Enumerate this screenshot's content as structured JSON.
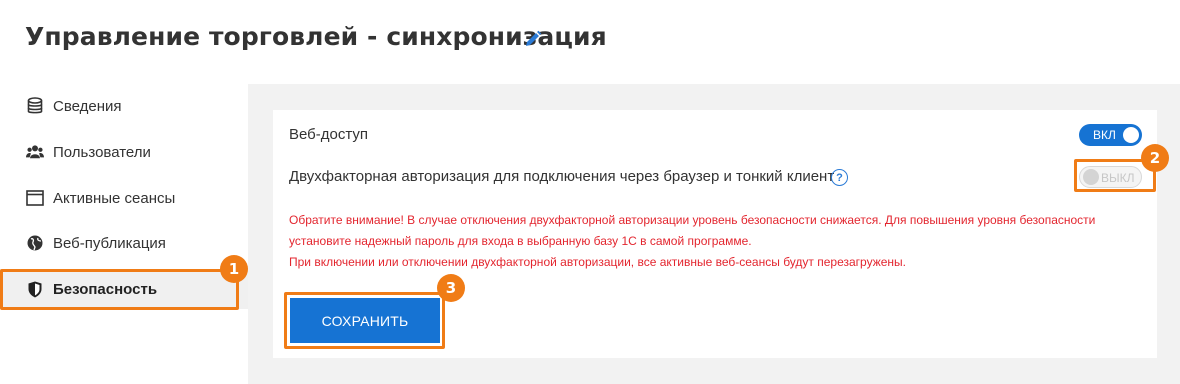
{
  "page": {
    "title": "Управление торговлей - синхронизация"
  },
  "sidebar": {
    "items": [
      {
        "label": "Сведения",
        "icon": "database-icon"
      },
      {
        "label": "Пользователи",
        "icon": "users-icon"
      },
      {
        "label": "Активные сеансы",
        "icon": "window-icon"
      },
      {
        "label": "Веб-публикация",
        "icon": "globe-icon"
      },
      {
        "label": "Безопасность",
        "icon": "shield-icon",
        "active": true
      }
    ]
  },
  "settings": {
    "web_access": {
      "label": "Веб-доступ",
      "toggle_label": "ВКЛ",
      "state": "on"
    },
    "two_factor": {
      "label": "Двухфакторная авторизация для подключения через браузер и тонкий клиент",
      "help": "?",
      "toggle_label": "ВЫКЛ",
      "state": "off"
    },
    "warning_lines": [
      "Обратите внимание! В случае отключения двухфакторной авторизации уровень безопасности снижается. Для повышения уровня безопасности",
      "установите надежный пароль для входа в выбранную базу 1С в самой программе.",
      "При включении или отключении двухфакторной авторизации, все активные веб-сеансы будут перезагружены."
    ]
  },
  "actions": {
    "save_label": "СОХРАНИТЬ"
  },
  "highlights": {
    "badge_1": "1",
    "badge_2": "2",
    "badge_3": "3"
  },
  "colors": {
    "accent": "#1673d3",
    "highlight": "#f07c16",
    "warning": "#e3262f"
  }
}
